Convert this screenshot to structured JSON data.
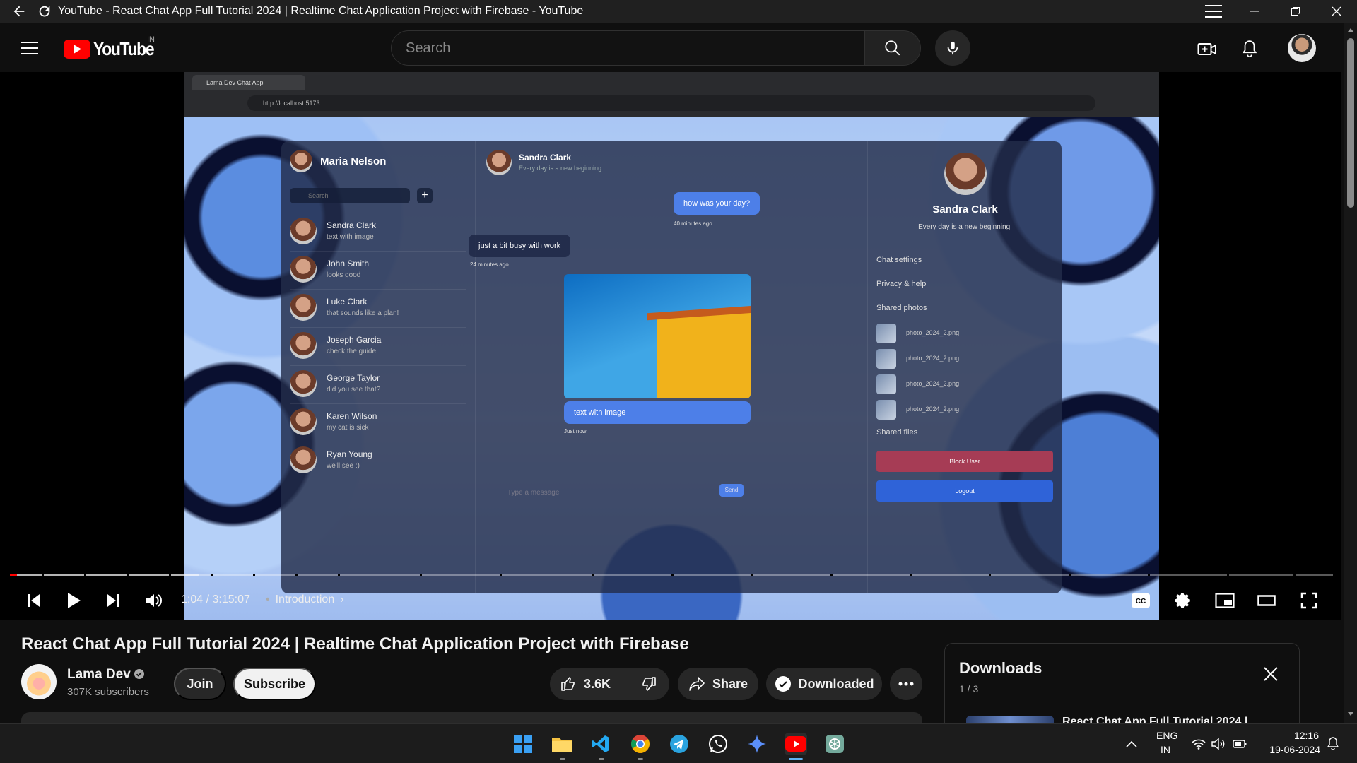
{
  "window": {
    "title": "YouTube - React Chat App Full Tutorial 2024 | Realtime Chat Application Project with Firebase - YouTube"
  },
  "masthead": {
    "logo_text": "YouTube",
    "country_code": "IN",
    "search_placeholder": "Search",
    "icons": [
      "menu-icon",
      "search-icon",
      "mic-icon",
      "create-icon",
      "bell-icon",
      "avatar"
    ]
  },
  "video_frame": {
    "browser_tab": "Lama Dev Chat App",
    "browser_url": "http://localhost:5173",
    "user_name": "Maria Nelson",
    "search_placeholder": "Search",
    "contacts": [
      {
        "name": "Sandra Clark",
        "msg": "text with image"
      },
      {
        "name": "John Smith",
        "msg": "looks good"
      },
      {
        "name": "Luke Clark",
        "msg": "that sounds like a plan!"
      },
      {
        "name": "Joseph Garcia",
        "msg": "check the guide"
      },
      {
        "name": "George Taylor",
        "msg": "did you see that?"
      },
      {
        "name": "Karen Wilson",
        "msg": "my cat is sick"
      },
      {
        "name": "Ryan Young",
        "msg": "we'll see :)"
      }
    ],
    "chat_header_name": "Sandra Clark",
    "chat_header_status": "Every day is a new beginning.",
    "messages": [
      {
        "text": "how was your day?",
        "time": "40 minutes ago"
      },
      {
        "text": "just a bit busy with work",
        "time": "24 minutes ago"
      },
      {
        "text": "text with image",
        "time": "Just now"
      }
    ],
    "message_placeholder": "Type a message",
    "send_label": "Send",
    "detail_name": "Sandra Clark",
    "detail_status": "Every day is a new beginning.",
    "chat_settings": "Chat settings",
    "privacy_help": "Privacy & help",
    "shared_photos": "Shared photos",
    "photos": [
      "photo_2024_2.png",
      "photo_2024_2.png",
      "photo_2024_2.png",
      "photo_2024_2.png"
    ],
    "shared_files": "Shared files",
    "block_user": "Block User",
    "logout": "Logout"
  },
  "player": {
    "time": "1:04 / 3:15:07",
    "chapter": "Introduction",
    "played_fraction": 0.0055,
    "buffered_fraction": 0.143,
    "accent": "#ff0000"
  },
  "video": {
    "title": "React Chat App Full Tutorial 2024 | Realtime Chat Application Project with Firebase",
    "channel_name": "Lama Dev",
    "subscribers": "307K subscribers",
    "join_label": "Join",
    "subscribe_label": "Subscribe",
    "likes": "3.6K",
    "share_label": "Share",
    "download_label": "Downloaded"
  },
  "downloads_panel": {
    "title": "Downloads",
    "count": "1 / 3",
    "item_title": "React Chat App Full Tutorial 2024 |"
  },
  "taskbar": {
    "apps": [
      "windows-start-icon",
      "file-explorer-icon",
      "vscode-icon",
      "chrome-icon",
      "telegram-icon",
      "whatsapp-icon",
      "gemini-icon",
      "youtube-icon",
      "chatgpt-icon"
    ],
    "lang_line1": "ENG",
    "lang_line2": "IN",
    "time": "12:16",
    "date": "19-06-2024"
  }
}
